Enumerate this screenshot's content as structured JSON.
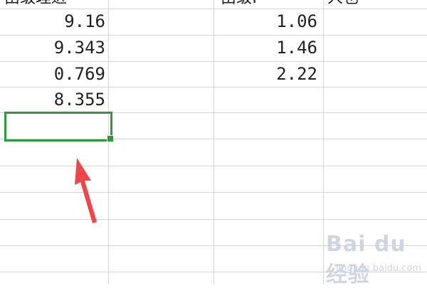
{
  "header": {
    "col_b_fragment": "由级理进",
    "col_c_fragment": "由级F",
    "col_d_fragment": "人也"
  },
  "column_b": [
    "9.16",
    "9.343",
    "0.769",
    "8.355",
    ""
  ],
  "column_c": [
    "1.06",
    "1.46",
    "2.22"
  ],
  "selection": {
    "color": "#2e9b3a"
  },
  "pointer_arrow": {
    "color": "#f2454a"
  },
  "watermark": {
    "logo": "Bai du 经验",
    "url": "jingyan.baidu.com"
  }
}
